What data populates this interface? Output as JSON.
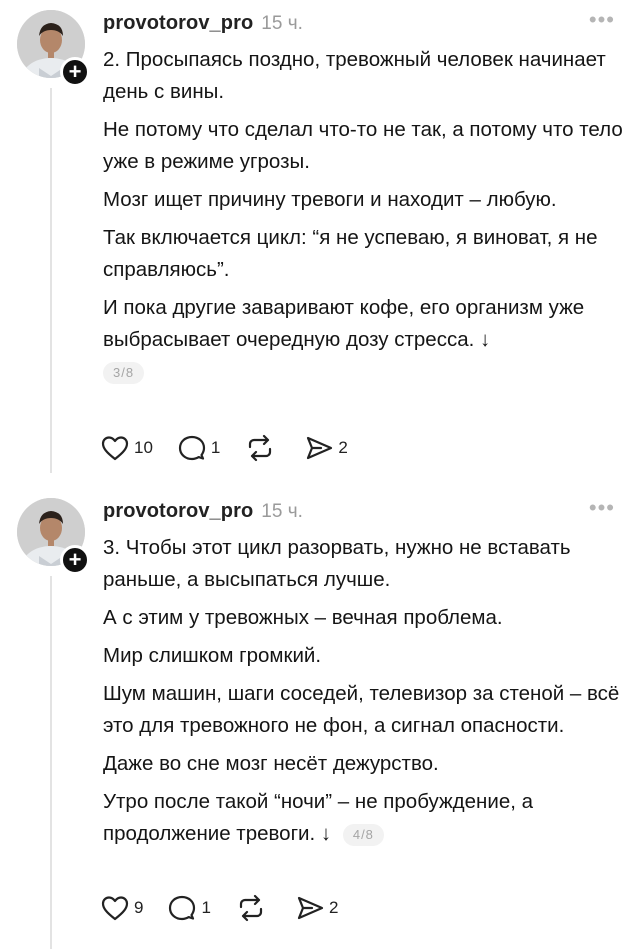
{
  "posts": [
    {
      "username": "provotorov_pro",
      "time": "15 ч.",
      "paragraphs": [
        "2. Просыпаясь поздно, тревожный человек начинает день с вины.",
        "Не потому что сделал что-то не так, а потому что тело уже в режиме угрозы.",
        "Мозг ищет причину тревоги и находит – любую.",
        "Так включается цикл: “я не успеваю, я виноват, я не справляюсь”.",
        "И пока другие заваривают кофе, его организм уже выбрасывает очередную дозу стресса. ↓"
      ],
      "page": "3/8",
      "likes": "10",
      "comments": "1",
      "reposts": "",
      "shares": "2"
    },
    {
      "username": "provotorov_pro",
      "time": "15 ч.",
      "paragraphs": [
        "3. Чтобы этот цикл разорвать, нужно не вставать раньше, а высыпаться лучше.",
        "А с этим у тревожных – вечная проблема.",
        "Мир слишком громкий.",
        "Шум машин, шаги соседей, телевизор за стеной – всё это для тревожного не фон, а сигнал опасности.",
        "Даже во сне мозг несёт дежурство.",
        "Утро после такой “ночи” – не пробуждение, а продолжение тревоги. ↓"
      ],
      "page": "4/8",
      "likes": "9",
      "comments": "1",
      "reposts": "",
      "shares": "2"
    }
  ],
  "icons": {
    "more": "more-horizontal-icon",
    "like": "heart-icon",
    "comment": "comment-icon",
    "repost": "repost-icon",
    "share": "send-icon",
    "follow": "plus-icon"
  }
}
